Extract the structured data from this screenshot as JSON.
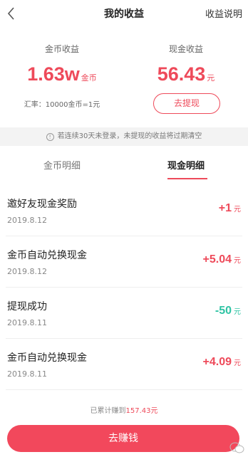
{
  "header": {
    "title": "我的收益",
    "right_link": "收益说明"
  },
  "summary": {
    "coin_label": "金币收益",
    "coin_value": "1.63w",
    "coin_unit": "金币",
    "cash_label": "现金收益",
    "cash_value": "56.43",
    "cash_unit": "元",
    "exchange_rate": "汇率：10000金币=1元",
    "withdraw_button": "去提现"
  },
  "notice": {
    "icon": "info-circle-icon",
    "text": "若连续30天未登录，未提现的收益将过期清空"
  },
  "tabs": [
    {
      "label": "金币明细",
      "active": false
    },
    {
      "label": "现金明细",
      "active": true
    }
  ],
  "records": [
    {
      "title": "邀好友现金奖励",
      "date": "2019.8.12",
      "amount": "+1",
      "unit": "元",
      "type": "income"
    },
    {
      "title": "金币自动兑换现金",
      "date": "2019.8.12",
      "amount": "+5.04",
      "unit": "元",
      "type": "income"
    },
    {
      "title": "提现成功",
      "date": "2019.8.11",
      "amount": "-50",
      "unit": "元",
      "type": "expense"
    },
    {
      "title": "金币自动兑换现金",
      "date": "2019.8.11",
      "amount": "+4.09",
      "unit": "元",
      "type": "income"
    }
  ],
  "footer": {
    "total_prefix": "已累计赚到",
    "total_amount": "157.43元",
    "earn_button": "去赚钱"
  },
  "colors": {
    "accent": "#ee4a5a",
    "income": "#ee4a5a",
    "expense": "#2fc4a4"
  }
}
